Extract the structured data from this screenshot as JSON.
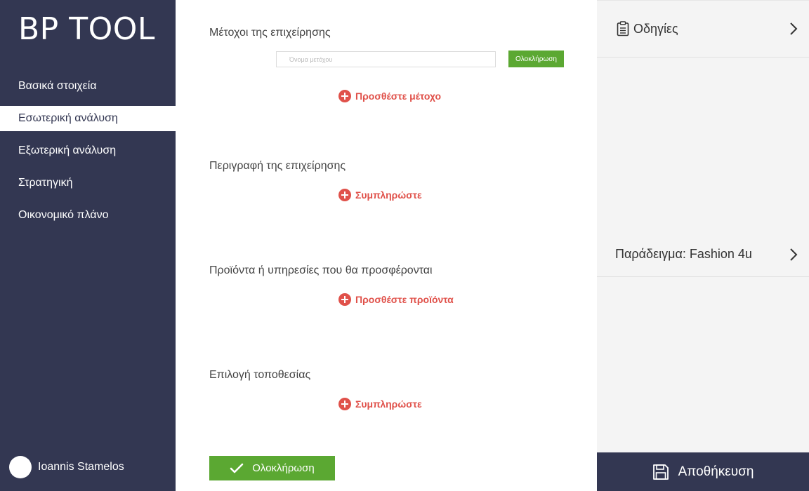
{
  "app": {
    "title": "BP TOOL"
  },
  "sidebar": {
    "items": [
      {
        "label": "Βασικά στοιχεία",
        "active": false
      },
      {
        "label": "Εσωτερική ανάλυση",
        "active": true
      },
      {
        "label": "Εξωτερική ανάλυση",
        "active": false
      },
      {
        "label": "Στρατηγική",
        "active": false
      },
      {
        "label": "Οικονομικό πλάνο",
        "active": false
      }
    ],
    "user": {
      "name": "Ioannis Stamelos"
    }
  },
  "main": {
    "shareholders": {
      "title": "Μέτοχοι της επιχείρησης",
      "input_placeholder": "Όνομα μετόχου",
      "input_value": "",
      "done_label": "Ολοκλήρωση",
      "add_label": "Προσθέστε μέτοχο"
    },
    "description": {
      "title": "Περιγραφή της επιχείρησης",
      "add_label": "Συμπληρώστε"
    },
    "products": {
      "title": "Προϊόντα ή υπηρεσίες που θα προσφέρονται",
      "add_label": "Προσθέστε προϊόντα"
    },
    "location": {
      "title": "Επιλογή τοποθεσίας",
      "add_label": "Συμπληρώστε"
    },
    "done_button_label": "Ολοκλήρωση"
  },
  "right_panel": {
    "instructions_label": "Οδηγίες",
    "example_label": "Παράδειγμα: Fashion 4u",
    "save_label": "Αποθήκευση"
  },
  "colors": {
    "sidebar_bg": "#333752",
    "accent_red": "#e0514a",
    "accent_green": "#5ba832",
    "panel_bg": "#f4f4f4"
  },
  "icons": {
    "add": "plus-circle-icon",
    "check": "check-icon",
    "clipboard": "clipboard-icon",
    "chevron": "chevron-right-icon",
    "save": "floppy-disk-icon"
  }
}
